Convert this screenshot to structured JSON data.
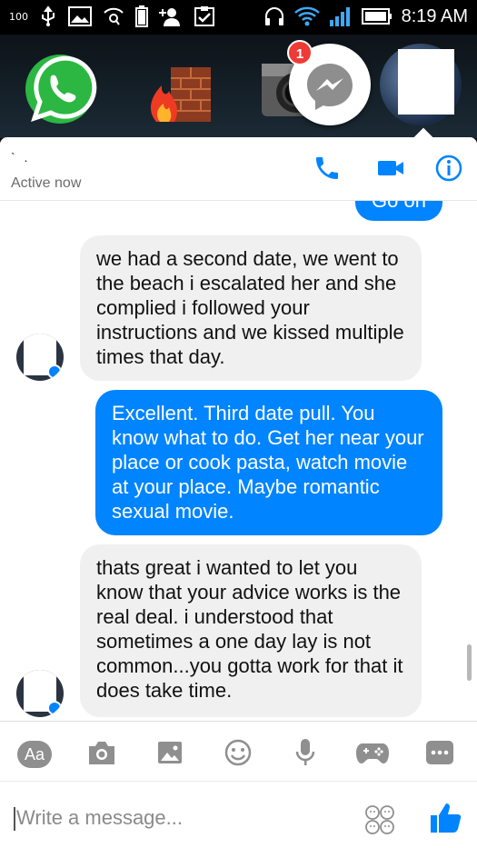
{
  "status_bar": {
    "battery_percent": "100",
    "time": "8:19 AM"
  },
  "notification": {
    "badge_count": "1"
  },
  "header": {
    "contact_name": "` .",
    "status": "Active now"
  },
  "messages": [
    {
      "direction": "outgoing",
      "text": "Go on"
    },
    {
      "direction": "incoming",
      "text": "we had a second date, we went to the beach i escalated her and she complied i followed your instructions and we kissed multiple times that day."
    },
    {
      "direction": "outgoing",
      "text": "Excellent. Third date pull. You know what to do. Get her near your place or cook pasta, watch movie at your place. Maybe romantic sexual movie."
    },
    {
      "direction": "incoming",
      "text": "thats great i wanted to let you know that your advice works is the real deal. i understood that sometimes a one day lay is not common...you gotta work for that it does take time."
    }
  ],
  "toolbar": {
    "aa_label": "Aa"
  },
  "composer": {
    "placeholder": "Write a message..."
  },
  "colors": {
    "accent": "#0084ff",
    "incoming_bubble": "#f0f0f0",
    "badge": "#ef3b35"
  },
  "icons": [
    "usb-icon",
    "image-icon",
    "search-icon",
    "battery-icon",
    "add-user-icon",
    "clipboard-icon",
    "headset-icon",
    "wifi-icon",
    "signal-icon",
    "phone-icon",
    "video-icon",
    "info-icon",
    "camera-icon",
    "gallery-icon",
    "emoji-icon",
    "mic-icon",
    "game-icon",
    "more-icon",
    "sticker-icon",
    "thumbs-up-icon"
  ]
}
